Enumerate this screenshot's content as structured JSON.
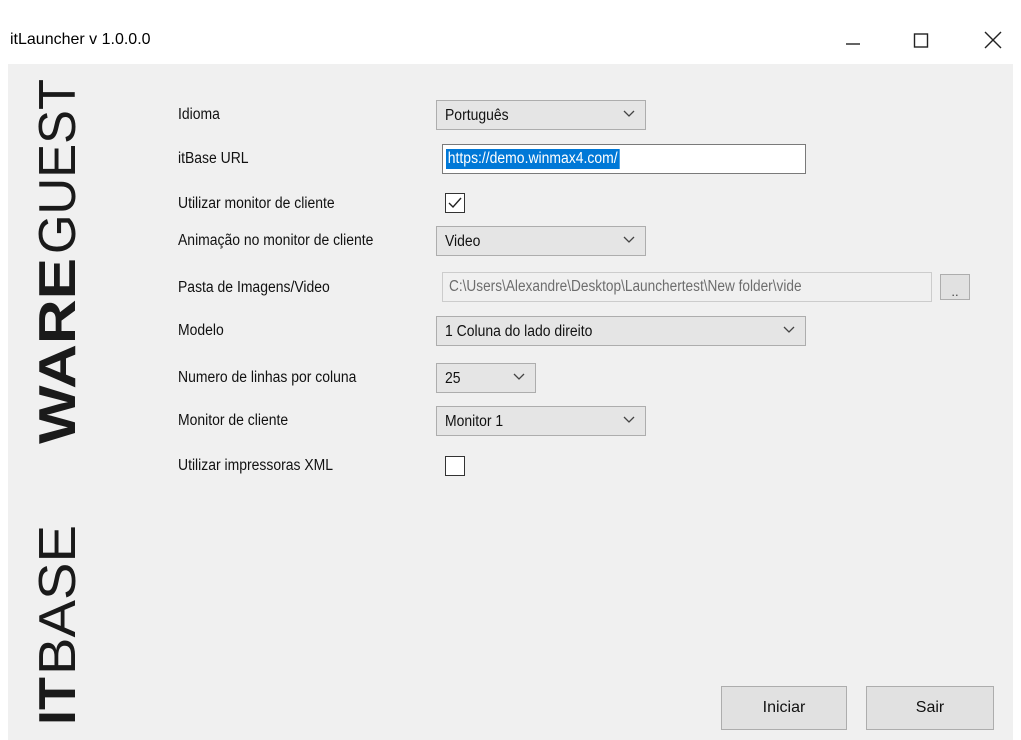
{
  "window": {
    "title": "itLauncher v 1.0.0.0",
    "controls": [
      "minimize-icon",
      "maximize-icon",
      "close-icon"
    ]
  },
  "branding": {
    "top_logo_text": "WAREGUEST",
    "bottom_logo_text": "ITBASE"
  },
  "form": {
    "idioma": {
      "label": "Idioma",
      "value": "Português"
    },
    "itbase_url": {
      "label": "itBase URL",
      "value": "https://demo.winmax4.com/"
    },
    "usar_monitor": {
      "label": "Utilizar monitor de cliente",
      "checked": true
    },
    "animacao": {
      "label": "Animação no monitor de cliente",
      "value": "Video"
    },
    "pasta": {
      "label": "Pasta de Imagens/Video",
      "value": "C:\\Users\\Alexandre\\Desktop\\Launchertest\\New folder\\vide",
      "browse_label": ".."
    },
    "modelo": {
      "label": "Modelo",
      "value": "1 Coluna do lado direito"
    },
    "linhas": {
      "label": "Numero de linhas por coluna",
      "value": "25"
    },
    "monitor": {
      "label": "Monitor de cliente",
      "value": "Monitor 1"
    },
    "xml": {
      "label": "Utilizar impressoras XML",
      "checked": false
    }
  },
  "buttons": {
    "start": "Iniciar",
    "exit": "Sair"
  },
  "colors": {
    "selection": "#0078d7",
    "dialog_bg": "#f0f0f0",
    "combo_bg": "#e5e5e5",
    "logo": "#1a1a1a"
  }
}
